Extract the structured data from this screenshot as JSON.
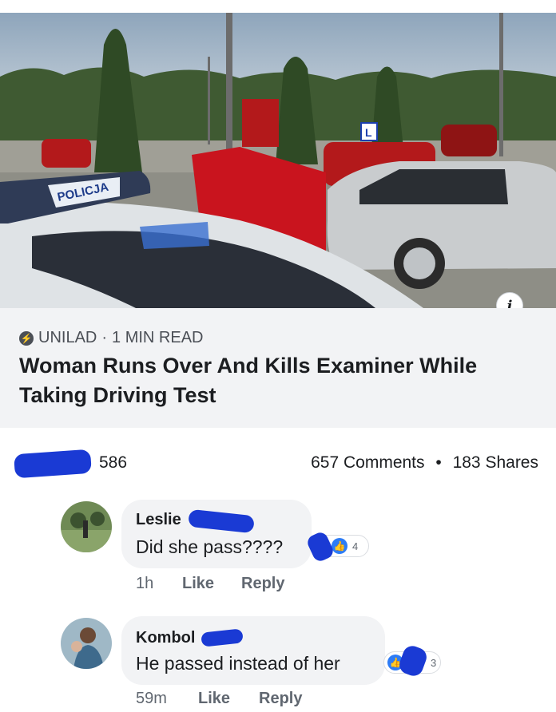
{
  "article": {
    "source": "UNILAD",
    "read_time": "1 MIN READ",
    "separator": "·",
    "headline": "Woman Runs Over And Kills Examiner While Taking Driving Test",
    "photo_sign_text": "POLICJA",
    "lot_sign_text": "L",
    "info_glyph": "i"
  },
  "stats": {
    "reactions": "586",
    "comments": "657 Comments",
    "dot": "•",
    "shares": "183 Shares"
  },
  "comments": [
    {
      "author": "Leslie",
      "text": "Did she pass????",
      "time": "1h",
      "like_label": "Like",
      "reply_label": "Reply",
      "reaction_count": "4"
    },
    {
      "author": "Kombol",
      "text": "He passed instead of her",
      "time": "59m",
      "like_label": "Like",
      "reply_label": "Reply",
      "reaction_count": "3"
    }
  ],
  "colors": {
    "redaction": "#1a3ad4",
    "like_blue": "#2d7cf6",
    "preview_bg": "#f2f3f5"
  }
}
